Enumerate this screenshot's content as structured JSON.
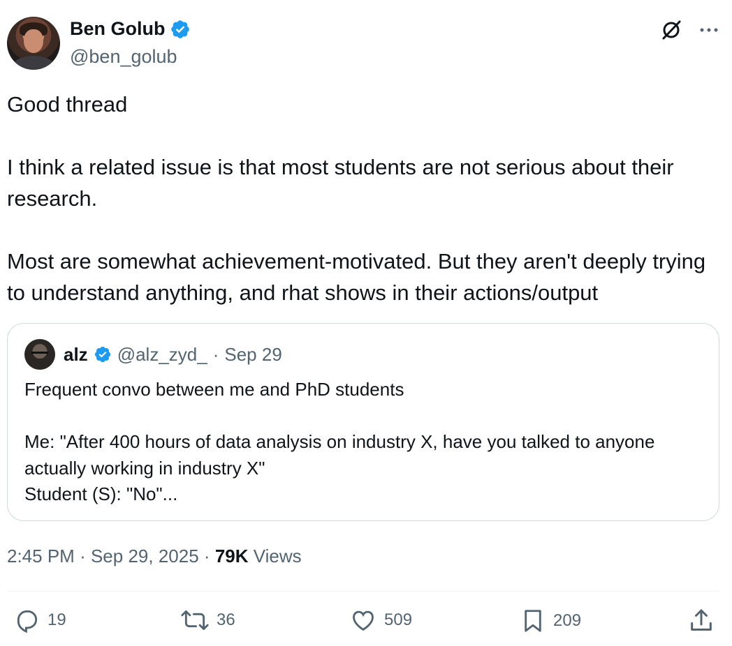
{
  "author": {
    "display_name": "Ben Golub",
    "handle": "@ben_golub",
    "verified": true
  },
  "header_icons": [
    "grok-slash-icon",
    "more-options-icon"
  ],
  "tweet": {
    "text": "Good thread\n\nI think a related issue is that most students are not serious about their research.\n\nMost are somewhat achievement-motivated. But they aren't deeply trying to understand anything, and rhat shows in their actions/output"
  },
  "quote": {
    "display_name": "alz",
    "handle": "@alz_zyd_",
    "separator": "·",
    "date": "Sep 29",
    "text": "Frequent convo between me and PhD students\n\nMe: \"After 400 hours of data analysis on industry X, have you talked to anyone actually working in industry X\"\nStudent (S): \"No\"..."
  },
  "meta": {
    "time": "2:45 PM",
    "sep1": "·",
    "date": "Sep 29, 2025",
    "sep2": "·",
    "views_count": "79K",
    "views_label": "Views"
  },
  "actions": {
    "replies": "19",
    "reposts": "36",
    "likes": "509",
    "bookmarks": "209"
  },
  "colors": {
    "verified_blue": "#1d9bf0",
    "secondary_text": "#536471",
    "primary_text": "#0f1419",
    "border": "#cfd9de"
  }
}
